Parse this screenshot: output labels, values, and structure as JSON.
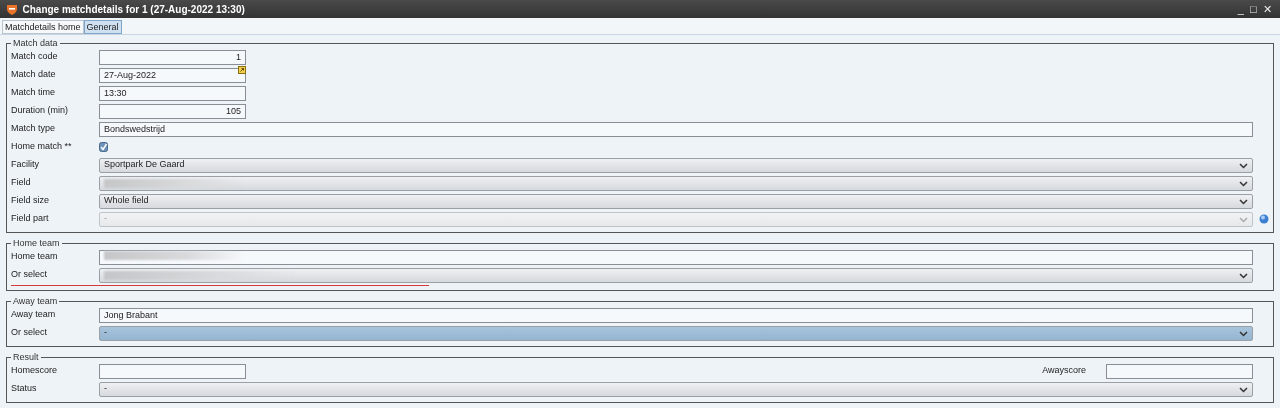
{
  "window": {
    "title": "Change matchdetails for 1 (27-Aug-2022 13:30)",
    "controls": [
      "_",
      "□",
      "✕"
    ]
  },
  "tabs": [
    {
      "label": "Matchdetails home",
      "selected": false
    },
    {
      "label": "General",
      "selected": true
    }
  ],
  "groups": [
    {
      "title": "Match data",
      "fields": [
        {
          "kind": "number",
          "label": "Match code",
          "value": "1"
        },
        {
          "kind": "date",
          "label": "Match date",
          "value": "27-Aug-2022"
        },
        {
          "kind": "short_text",
          "label": "Match time",
          "value": "13:30"
        },
        {
          "kind": "number",
          "label": "Duration (min)",
          "value": "105"
        },
        {
          "kind": "text",
          "label": "Match type",
          "value": "Bondswedstrijd"
        },
        {
          "kind": "checkbox",
          "label": "Home match **",
          "checked": true
        },
        {
          "kind": "select",
          "label": "Facility",
          "value": "Sportpark De Gaard",
          "disabled": false,
          "focused": false
        },
        {
          "kind": "select",
          "label": "Field",
          "blurred": true,
          "disabled": false,
          "focused": false
        },
        {
          "kind": "select",
          "label": "Field size",
          "value": "Whole field",
          "disabled": false,
          "focused": false
        },
        {
          "kind": "select",
          "label": "Field part",
          "value": "-",
          "disabled": true,
          "focused": false,
          "help": true
        }
      ]
    },
    {
      "title": "Home team",
      "invalid": true,
      "fields": [
        {
          "kind": "text",
          "label": "Home team",
          "blurred": true
        },
        {
          "kind": "select",
          "label": "Or select",
          "blurred": true,
          "disabled": false,
          "focused": false
        }
      ]
    },
    {
      "title": "Away team",
      "fields": [
        {
          "kind": "text",
          "label": "Away team",
          "value": "Jong Brabant"
        },
        {
          "kind": "select",
          "label": "Or select",
          "value": "-",
          "disabled": false,
          "focused": true
        }
      ]
    },
    {
      "title": "Result",
      "fields": [
        {
          "kind": "score",
          "label": "Homescore",
          "other_label": "Awayscore"
        },
        {
          "kind": "select",
          "label": "Status",
          "value": "-",
          "disabled": false,
          "focused": false
        }
      ]
    }
  ]
}
